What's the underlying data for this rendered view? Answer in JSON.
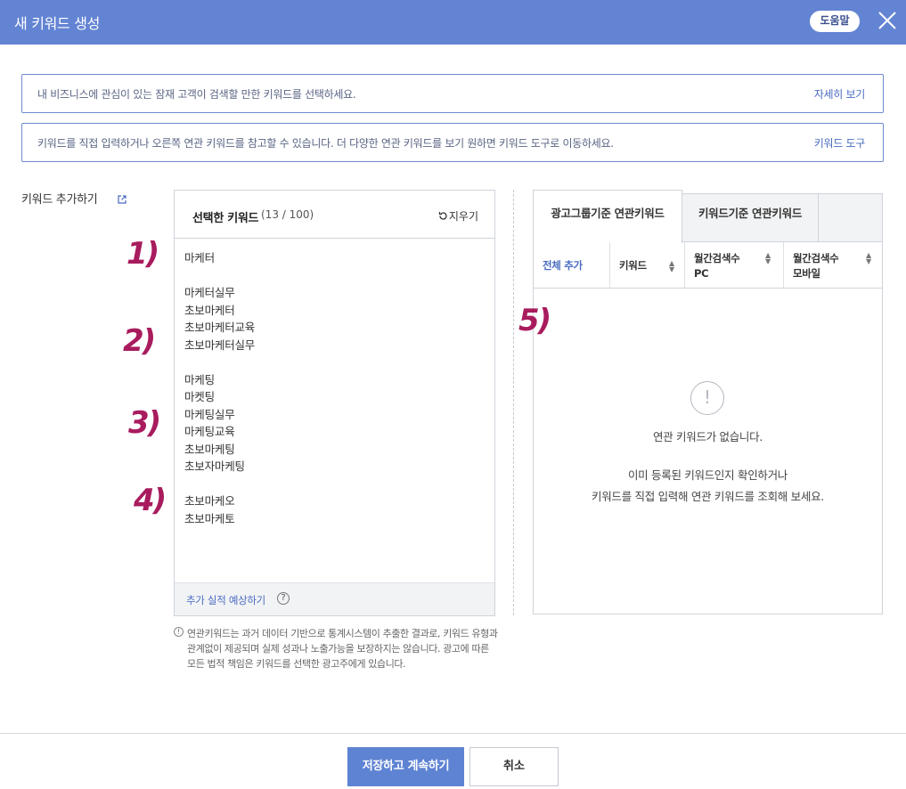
{
  "header": {
    "title": "새 키워드 생성",
    "help_label": "도움말"
  },
  "notices": [
    {
      "text": "내 비즈니스에 관심이 있는 잠재 고객이 검색할 만한 키워드를 선택하세요.",
      "link": "자세히 보기"
    },
    {
      "text": "키워드를 직접 입력하거나 오른쪽 연관 키워드를 참고할 수 있습니다. 더 다양한 연관 키워드를 보기 원하면 키워드 도구로 이동하세요.",
      "link": "키워드 도구"
    }
  ],
  "add_keywords_label": "키워드 추가하기",
  "selected": {
    "title": "선택한 키워드",
    "count": "(13 / 100)",
    "clear_label": "지우기",
    "keywords": [
      "마케터",
      "",
      "마케터실무",
      "초보마케터",
      "초보마케터교육",
      "초보마케터실무",
      "",
      "마케팅",
      "마켓팅",
      "마케팅실무",
      "마케팅교육",
      "초보마케팅",
      "초보자마케팅",
      "",
      "초보마케오",
      "초보마케토"
    ],
    "footer_link": "추가 실적 예상하기",
    "help_glyph": "?"
  },
  "disclaimer": "연관키워드는 과거 데이터 기반으로 통계시스템이 추출한 결과로, 키워드 유형과 관계없이 제공되며 실제 성과나 노출가능을 보장하지는 않습니다. 광고에 따른 모든 법적 책임은 키워드를 선택한 광고주에게 있습니다.",
  "related": {
    "tabs": [
      "광고그룹기준 연관키워드",
      "키워드기준 연관키워드"
    ],
    "columns": {
      "add_all": "전체 추가",
      "keyword": "키워드",
      "pc_line1": "월간검색수",
      "pc_line2": "PC",
      "mobile_line1": "월간검색수",
      "mobile_line2": "모바일"
    },
    "empty_title": "연관 키워드가 없습니다.",
    "empty_line1": "이미 등록된 키워드인지 확인하거나",
    "empty_line2": "키워드를 직접 입력해 연관 키워드를 조회해 보세요."
  },
  "annotations": [
    "1)",
    "2)",
    "3)",
    "4)",
    "5)"
  ],
  "footer": {
    "save_label": "저장하고 계속하기",
    "cancel_label": "취소"
  },
  "colors": {
    "header": "#6384d3",
    "accent": "#5f83d3",
    "link": "#4a6bc1",
    "annotation": "#a81c5e"
  },
  "icons": [
    "close-icon",
    "external-link-icon",
    "refresh-icon",
    "help-icon",
    "info-icon",
    "alert-icon",
    "sort-icon"
  ]
}
